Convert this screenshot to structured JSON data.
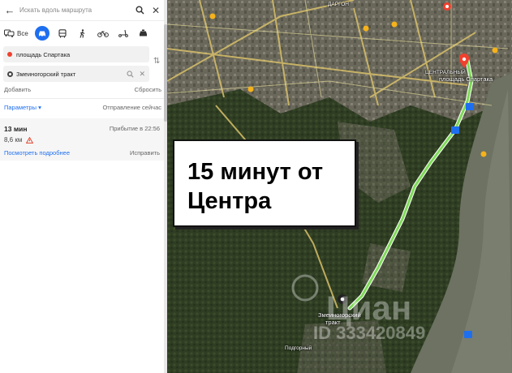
{
  "search": {
    "placeholder": "Искать вдоль маршрута"
  },
  "modes": {
    "all_label": "Все"
  },
  "points": {
    "from": "площадь Спартака",
    "to": "Змеиногорский тракт"
  },
  "actions": {
    "add": "Добавить",
    "reset": "Сбросить"
  },
  "params": {
    "label": "Параметры ▾",
    "departure": "Отправление сейчас"
  },
  "route": {
    "time": "13 мин",
    "arrival": "Прибытие в 22:56",
    "distance": "8,6 км",
    "more": "Посмотреть подробнее",
    "fix": "Исправить"
  },
  "callout": {
    "line1": "15 минут от",
    "line2": "Центра"
  },
  "map_labels": {
    "start": "площадь Спартака",
    "center": "ЦЕНТРАЛЬНЫЙ",
    "end_line1": "Змеиногорский",
    "end_line2": "тракт",
    "district_top": "ДАРГОН",
    "bottom": "Подгорный"
  },
  "watermark": {
    "brand": "Циан",
    "id": "ID 333420849"
  },
  "colors": {
    "accent": "#1e6ff0",
    "route": "#7ed957",
    "start_pin": "#f0402e"
  }
}
